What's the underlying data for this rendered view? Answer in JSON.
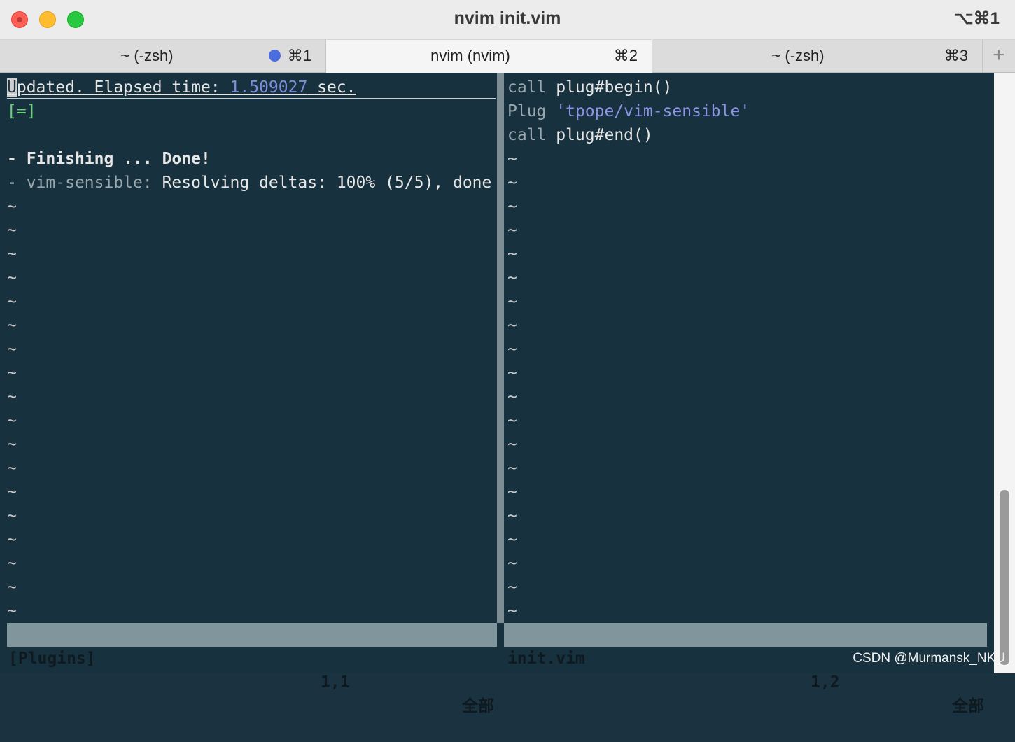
{
  "window": {
    "title": "nvim init.vim",
    "shortcut": "⌥⌘1"
  },
  "tabs": [
    {
      "label": "~ (-zsh)",
      "shortcut": "⌘1"
    },
    {
      "label": "nvim (nvim)",
      "shortcut": "⌘2"
    },
    {
      "label": "~ (-zsh)",
      "shortcut": "⌘3"
    }
  ],
  "tab_add": "+",
  "left_pane": {
    "cursor_char": "U",
    "line1_a": "pdated. ",
    "line1_b": "Elapsed",
    "line1_c": " time: ",
    "elapsed": "1.509027",
    "line1_d": " sec.",
    "progress": "[=]",
    "finishing_dash": "- ",
    "finishing": "Finishing ... Done!",
    "plugin_dash": "- ",
    "plugin_name": "vim-sensible:",
    "plugin_msg": " Resolving deltas: 100% (5/5), done",
    "tilde": "~",
    "status_name": "[Plugins]",
    "status_pos": "1,1",
    "status_all": "全部"
  },
  "right_pane": {
    "lines": [
      {
        "kw": "call",
        "rest": " plug#begin()"
      },
      {
        "kw": "Plug",
        "str": "'tpope/vim-sensible'"
      },
      {
        "kw": "call",
        "rest": " plug#end()"
      }
    ],
    "tilde": "~",
    "status_name": "init.vim",
    "status_pos": "1,2",
    "status_all": "全部"
  },
  "watermark": "CSDN @Murmansk_NKU"
}
